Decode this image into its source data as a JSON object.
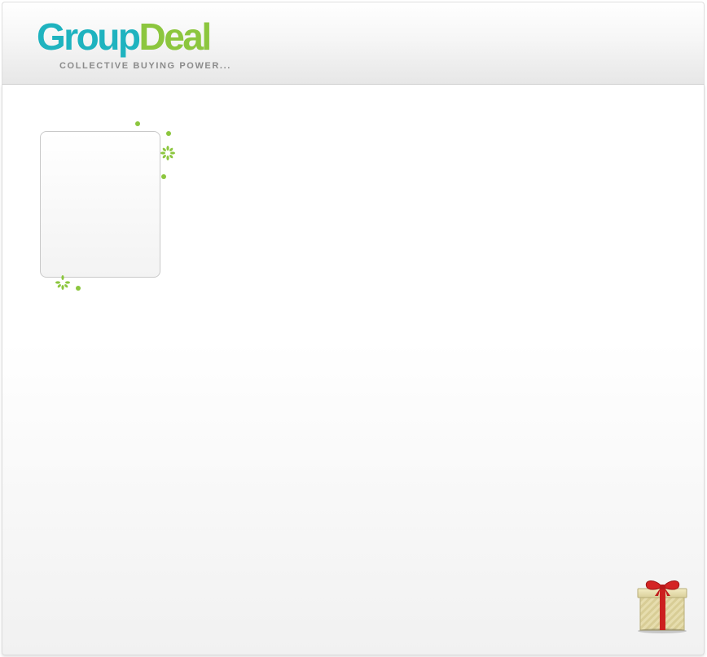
{
  "header": {
    "logo": {
      "word_part1": "Group",
      "word_part2": "Deal",
      "tagline": "COLLECTIVE BUYING POWER...",
      "color_group": "#1fb3bf",
      "color_deal": "#8cc63e"
    }
  },
  "main": {
    "image_card": {
      "state": "empty"
    },
    "decoration_color": "#8cc63e"
  },
  "gift_widget": {
    "icon": "gift-box-icon",
    "ribbon_color": "#cc1f1f",
    "box_color": "#e8dfae"
  }
}
